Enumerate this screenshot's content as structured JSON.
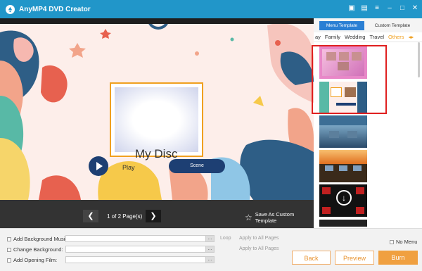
{
  "app": {
    "title": "AnyMP4 DVD Creator"
  },
  "window_controls": [
    "save-icon",
    "file-icon",
    "menu-icon",
    "minimize-icon",
    "maximize-icon",
    "close-icon"
  ],
  "preview": {
    "disc_title": "My Disc",
    "play_label": "Play",
    "scene_label": "Scene"
  },
  "pager": {
    "page_text": "1 of 2 Page(s)",
    "prev_icon": "chevron-left-icon",
    "next_icon": "chevron-right-icon",
    "save_template_label": "Save As Custom Template"
  },
  "sidebar": {
    "tabs": {
      "menu": "Menu Template",
      "custom": "Custom Template"
    },
    "categories": [
      "ay",
      "Family",
      "Wedding",
      "Travel",
      "Others"
    ],
    "selected_category": "Others"
  },
  "options": {
    "bg_music": "Add Background Music:",
    "loop": "Loop",
    "apply1": "Apply to All Pages",
    "change_bg": "Change Background:",
    "apply2": "Apply to All Pages",
    "opening_film": "Add Opening Film:",
    "no_menu": "No Menu",
    "dots": "..."
  },
  "buttons": {
    "back": "Back",
    "preview": "Preview",
    "burn": "Burn"
  },
  "colors": {
    "titlebar": "#2196c9",
    "accent": "#f0a040",
    "selection": "#e02020"
  }
}
